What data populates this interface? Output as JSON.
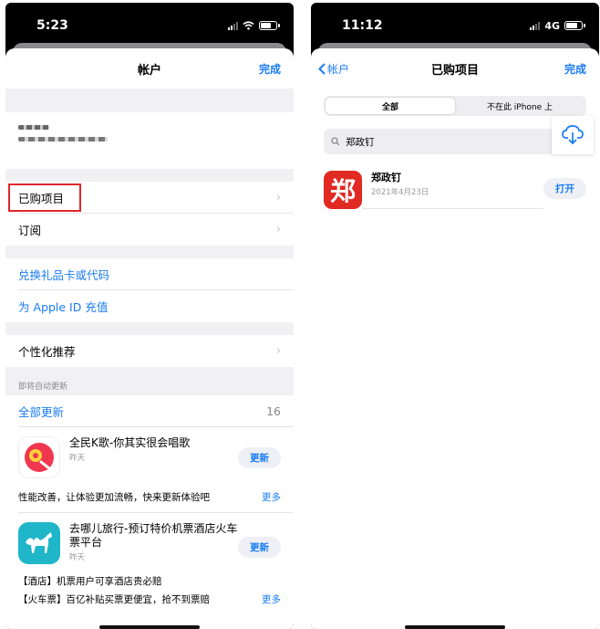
{
  "left": {
    "status": {
      "time": "5:23"
    },
    "nav": {
      "title": "帐户",
      "done": "完成"
    },
    "rows": {
      "purchased": "已购项目",
      "subscriptions": "订阅",
      "redeem": "兑换礼品卡或代码",
      "add_funds": "为 Apple ID 充值",
      "personalized": "个性化推荐"
    },
    "updates": {
      "caption": "即将自动更新",
      "update_all": "全部更新",
      "count": "16",
      "apps": [
        {
          "name": "全民K歌-你其实很会唱歌",
          "date": "昨天",
          "button": "更新",
          "notes": [
            "性能改善，让体验更加流畅，快来更新体验吧"
          ],
          "more": "更多",
          "icon": "karaoke-app-icon",
          "color": "#f0374f"
        },
        {
          "name": "去哪儿旅行-预订特价机票酒店火车票平台",
          "date": "昨天",
          "button": "更新",
          "notes": [
            "【酒店】机票用户可享酒店贵必赔",
            "【火车票】百亿补贴买票更便宜，抢不到票赔"
          ],
          "more": "更多",
          "icon": "qunar-app-icon",
          "color": "#1fb6c9"
        }
      ]
    }
  },
  "right": {
    "status": {
      "time": "11:12",
      "network": "4G"
    },
    "nav": {
      "back": "帐户",
      "title": "已购项目",
      "done": "完成"
    },
    "segments": {
      "all": "全部",
      "not_on_device": "不在此 iPhone 上"
    },
    "search": {
      "value": "郑政钉"
    },
    "result": {
      "name": "郑政钉",
      "date": "2021年4月23日",
      "button": "打开",
      "icon_char": "郑",
      "icon_color": "#e02a22"
    }
  },
  "colors": {
    "accent": "#1a7cf3",
    "highlight": "#e0262a"
  }
}
